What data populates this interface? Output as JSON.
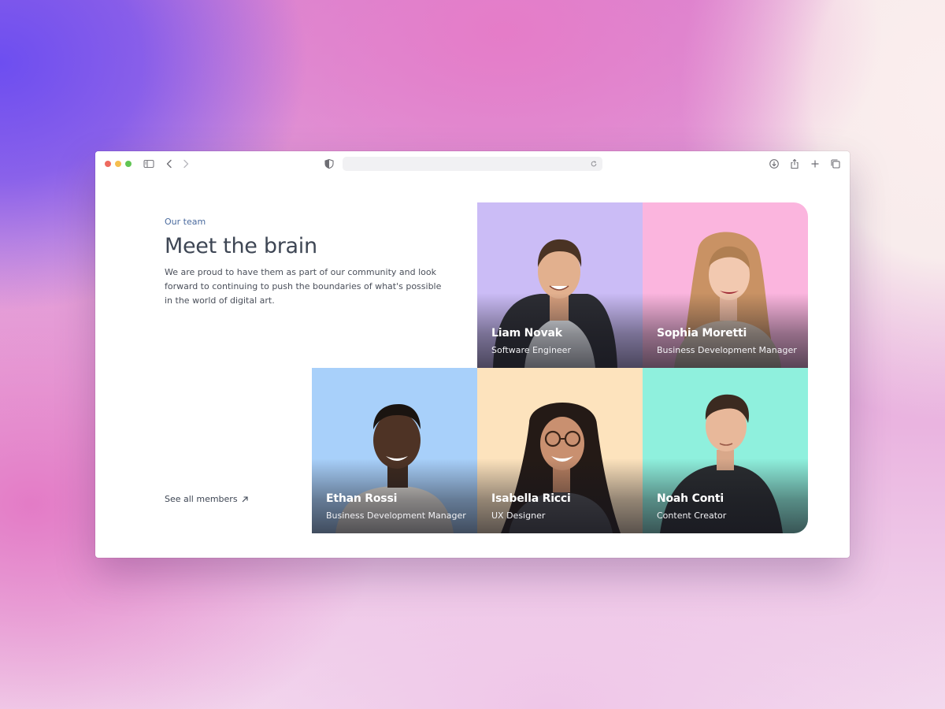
{
  "section": {
    "eyebrow": "Our team",
    "title": "Meet the brain",
    "description": "We are proud to have them as part of our community and look forward to continuing to push the boundaries of what's possible in the world of digital art.",
    "see_all_label": "See all members"
  },
  "members": [
    {
      "name": "Liam Novak",
      "role": "Software Engineer",
      "bg_color": "#cbbcf6"
    },
    {
      "name": "Sophia Moretti",
      "role": "Business Development Manager",
      "bg_color": "#fbb5de"
    },
    {
      "name": "Ethan Rossi",
      "role": "Business Development Manager",
      "bg_color": "#a8d0fa"
    },
    {
      "name": "Isabella Ricci",
      "role": "UX Designer",
      "bg_color": "#fde3bd"
    },
    {
      "name": "Noah Conti",
      "role": "Content Creator",
      "bg_color": "#8ff0dd"
    }
  ],
  "icons": {
    "window_controls": [
      "close-dot",
      "minimize-dot",
      "zoom-dot"
    ],
    "toolbar_left": [
      "sidebar-icon",
      "back-chevron-icon",
      "forward-chevron-icon"
    ],
    "address": [
      "shield-icon",
      "reload-icon"
    ],
    "toolbar_right": [
      "download-icon",
      "share-icon",
      "plus-icon",
      "tabs-icon"
    ],
    "link": "arrow-up-right-icon"
  },
  "colors": {
    "eyebrow": "#4a6a9e",
    "heading": "#3e4654",
    "body_text": "#4a4f5a"
  }
}
